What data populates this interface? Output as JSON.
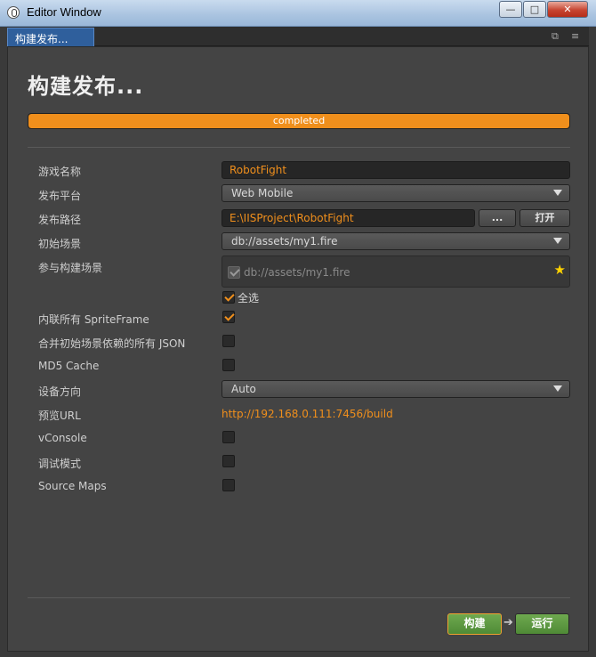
{
  "window": {
    "title": "Editor Window",
    "min_glyph": "—",
    "max_glyph": "□",
    "close_glyph": "✕"
  },
  "tab": {
    "label": "构建发布...",
    "popout_glyph": "⧉",
    "menu_glyph": "≡"
  },
  "page": {
    "title": "构建发布..."
  },
  "progress": {
    "value_fraction": 1.0,
    "text": "completed",
    "color": "#f08f1c"
  },
  "form": {
    "game_name": {
      "label": "游戏名称",
      "value": "RobotFight"
    },
    "platform": {
      "label": "发布平台",
      "value": "Web Mobile"
    },
    "path": {
      "label": "发布路径",
      "value": "E:\\IISProject\\RobotFight",
      "browse_label": "...",
      "open_label": "打开"
    },
    "start_scene": {
      "label": "初始场景",
      "value": "db://assets/my1.fire"
    },
    "scenes": {
      "label": "参与构建场景",
      "items": [
        "db://assets/my1.fire"
      ],
      "select_all_label": "全选"
    },
    "inline_spriteframe": {
      "label": "内联所有 SpriteFrame",
      "checked": true
    },
    "merge_json": {
      "label": "合并初始场景依赖的所有 JSON",
      "checked": false
    },
    "md5_cache": {
      "label": "MD5 Cache",
      "checked": false
    },
    "orientation": {
      "label": "设备方向",
      "value": "Auto"
    },
    "preview_url": {
      "label": "预览URL",
      "value": "http://192.168.0.111:7456/build"
    },
    "vconsole": {
      "label": "vConsole",
      "checked": false
    },
    "debug_mode": {
      "label": "调试模式",
      "checked": false
    },
    "source_maps": {
      "label": "Source Maps",
      "checked": false
    }
  },
  "actions": {
    "build_label": "构建",
    "run_label": "运行",
    "arrow_glyph": "➔"
  },
  "colors": {
    "accent": "#f08f1c",
    "tab_active": "#2f5f9c",
    "button_green": "#5c9a41",
    "star": "#ffd200"
  }
}
